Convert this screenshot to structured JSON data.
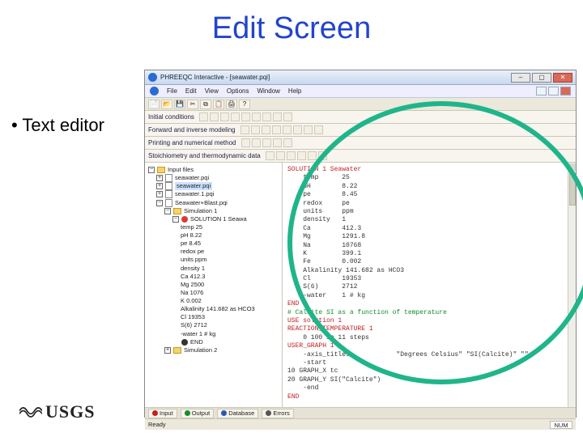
{
  "slide_title": "Edit Screen",
  "bullet_text": "Text editor",
  "usgs_text": "USGS",
  "window": {
    "title": "PHREEQC Interactive - [seawater.pqi]",
    "menu": [
      "File",
      "Edit",
      "View",
      "Options",
      "Window",
      "Help"
    ],
    "ribbons": [
      {
        "label": "Initial conditions"
      },
      {
        "label": "Forward and inverse modeling"
      },
      {
        "label": "Printing and numerical method"
      },
      {
        "label": "Stoichiometry and thermodynamic data"
      }
    ],
    "tree": {
      "root": "Input files",
      "items": [
        "seawater.pqi",
        "seawater.pqi",
        "seawater.1.pqi",
        "Seawater+Blast.pqi"
      ],
      "sim": "Simulation 1",
      "sol": "SOLUTION 1 Seawa",
      "props": [
        "temp  25",
        "pH  8.22",
        "pe  8.45",
        "redox  pe",
        "units ppm",
        "density 1",
        "Ca  412.3",
        "Mg  2500",
        "Na  1076",
        "K   0.002",
        "Alkalinity 141.682 as HCO3",
        "Cl  19353",
        "S(6) 2712",
        "-water  1 # kg"
      ],
      "end": "END",
      "sim2": "Simulation 2"
    },
    "editor_lines": [
      "SOLUTION 1 Seawater",
      "    temp      25",
      "    pH        8.22",
      "    pe        8.45",
      "    redox     pe",
      "    units     ppm",
      "    density   1",
      "    Ca        412.3",
      "    Mg        1291.8",
      "    Na        10768",
      "    K         399.1",
      "    Fe        0.002",
      "    Alkalinity 141.682 as HCO3",
      "    Cl        19353",
      "    S(6)      2712",
      "    -water    1 # kg",
      "",
      "END",
      "# Calcite SI as a function of temperature",
      "USE solution 1",
      "REACTION_TEMPERATURE 1",
      "    0 100 in 11 steps",
      "USER_GRAPH 1",
      "    -axis_titles            \"Degrees Celsius\" \"SI(Calcite)\" \"\"",
      "    -start",
      "10 GRAPH_X tc",
      "20 GRAPH_Y SI(\"Calcite\")",
      "    -end",
      "END"
    ],
    "keyword_lines": [
      0,
      17,
      19,
      20,
      22,
      28
    ],
    "comment_lines": [
      18
    ],
    "bottom_tabs": [
      "Input",
      "Output",
      "Database",
      "Errors"
    ],
    "status_left": "Ready",
    "status_right": "NUM"
  }
}
